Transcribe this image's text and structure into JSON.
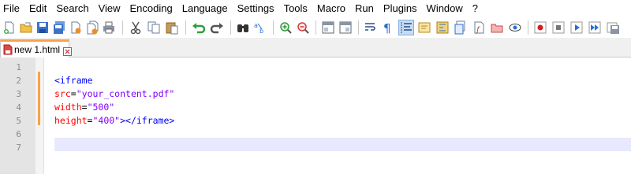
{
  "menu": [
    "File",
    "Edit",
    "Search",
    "View",
    "Encoding",
    "Language",
    "Settings",
    "Tools",
    "Macro",
    "Run",
    "Plugins",
    "Window",
    "?"
  ],
  "toolbar_icons": [
    "new-file-icon",
    "open-file-icon",
    "save-icon",
    "save-all-icon",
    "close-icon",
    "close-all-icon",
    "print-icon",
    "cut-icon",
    "copy-icon",
    "paste-icon",
    "undo-icon",
    "redo-icon",
    "find-icon",
    "replace-icon",
    "zoom-in-icon",
    "zoom-out-icon",
    "sync-vertical-icon",
    "sync-horizontal-icon",
    "word-wrap-icon",
    "show-all-characters-icon",
    "indent-guide-icon",
    "user-language-icon",
    "document-map-icon",
    "function-list-icon",
    "folder-as-workspace-icon",
    "document-list-icon",
    "monitoring-icon",
    "record-macro-icon",
    "stop-record-icon",
    "play-macro-icon",
    "run-macro-multiple-icon",
    "save-macro-icon"
  ],
  "tab": {
    "label": "new 1.html"
  },
  "editor": {
    "line_numbers": [
      "1",
      "2",
      "3",
      "4",
      "5",
      "6",
      "7"
    ],
    "lines": {
      "l2": {
        "tag": "<iframe"
      },
      "l3": {
        "attr": "src",
        "eq": "=",
        "val": "\"your_content.pdf\""
      },
      "l4": {
        "attr": "width",
        "eq": "=",
        "val": "\"500\""
      },
      "l5": {
        "attr": "height",
        "eq": "=",
        "val": "\"400\"",
        "close": "></iframe>"
      }
    }
  },
  "colors": {
    "tag": "#0000ff",
    "attribute": "#ff0000",
    "value": "#8000ff",
    "modified_marker": "#f7a34b",
    "current_line": "#e8e8ff",
    "gutter": "#e4e4e4"
  }
}
